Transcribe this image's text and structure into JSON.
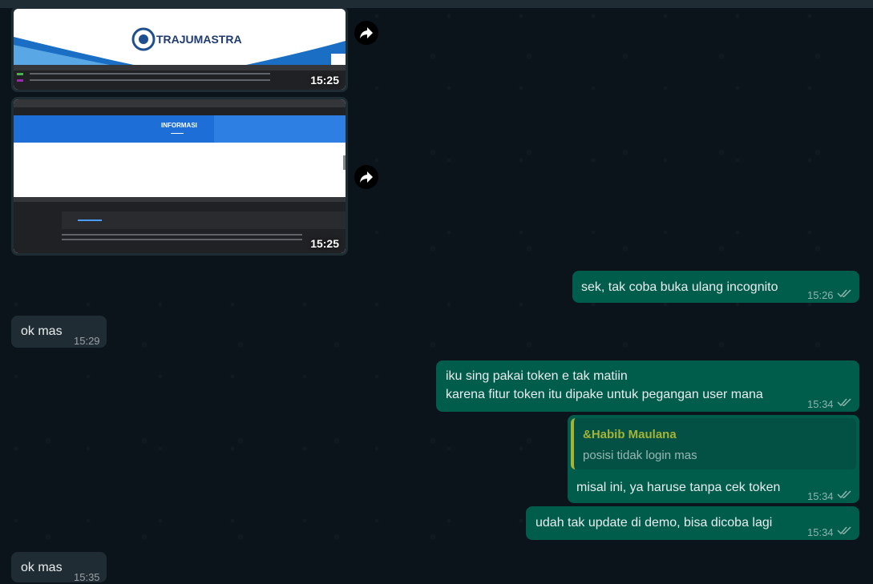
{
  "screenshot1": {
    "brand": "TRAJUMASTRA",
    "time": "15:25"
  },
  "screenshot2": {
    "banner_title": "INFORMASI",
    "time": "15:25"
  },
  "messages": [
    {
      "text": "sek, tak coba buka ulang incognito",
      "time": "15:26"
    },
    {
      "text": "ok mas",
      "time": "15:29"
    },
    {
      "line1": "iku sing pakai token e tak matiin",
      "line2": "karena fitur token itu dipake untuk pegangan user mana",
      "time": "15:34"
    },
    {
      "quote_author": "&Habib Maulana",
      "quote_text": "posisi tidak login mas",
      "text": "misal ini, ya haruse tanpa cek token",
      "time": "15:34"
    },
    {
      "text": "udah tak update di demo, bisa dicoba lagi",
      "time": "15:34"
    },
    {
      "text": "ok mas",
      "time": "15:35"
    }
  ],
  "colors": {
    "background": "#0b141a",
    "incoming": "#202c33",
    "outgoing": "#005c4b",
    "quote_bar": "#a5b337",
    "quote_author": "#a5b337"
  },
  "icons": [
    "forward-icon",
    "double-check-icon"
  ]
}
